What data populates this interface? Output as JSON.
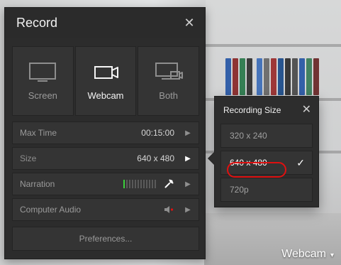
{
  "panel": {
    "title": "Record",
    "close_symbol": "✕"
  },
  "sources": [
    {
      "label": "Screen",
      "active": false,
      "icon": "monitor-icon"
    },
    {
      "label": "Webcam",
      "active": true,
      "icon": "camera-icon"
    },
    {
      "label": "Both",
      "active": false,
      "icon": "monitor-camera-icon"
    }
  ],
  "settings": {
    "max_time": {
      "label": "Max Time",
      "value": "00:15:00"
    },
    "size": {
      "label": "Size",
      "value": "640 x 480"
    },
    "narration": {
      "label": "Narration"
    },
    "computer_audio": {
      "label": "Computer Audio"
    }
  },
  "preferences": {
    "label": "Preferences..."
  },
  "popup": {
    "title": "Recording Size",
    "close_symbol": "✕",
    "options": [
      {
        "label": "320 x 240",
        "selected": false
      },
      {
        "label": "640 x 480",
        "selected": true
      },
      {
        "label": "720p",
        "selected": false
      }
    ],
    "check_symbol": "✓"
  },
  "footer": {
    "camera_label": "Webcam",
    "caret_symbol": "▾"
  },
  "colors": {
    "panel_bg": "#2c2c2c",
    "tile_bg": "#343434",
    "accent_green": "#3bd13b",
    "annotation_red": "#e01010"
  }
}
